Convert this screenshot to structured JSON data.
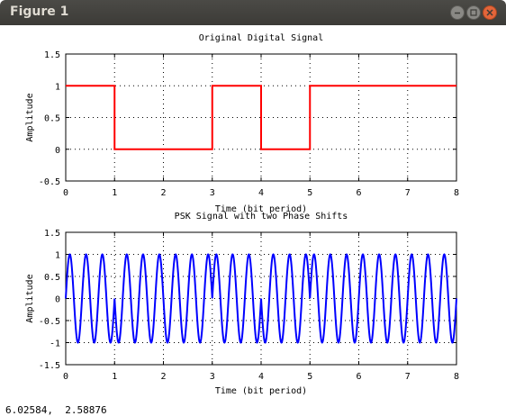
{
  "window": {
    "title": "Figure 1"
  },
  "status": {
    "coords": "6.02584,  2.58876"
  },
  "chart_data": [
    {
      "type": "line",
      "title": "Original Digital Signal",
      "xlabel": "Time (bit period)",
      "ylabel": "Amplitude",
      "xlim": [
        0,
        8
      ],
      "ylim": [
        -0.5,
        1.5
      ],
      "xticks": [
        "0",
        "1",
        "2",
        "3",
        "4",
        "5",
        "6",
        "7",
        "8"
      ],
      "yticks": [
        "-0.5",
        "0",
        "0.5",
        "1",
        "1.5"
      ],
      "grid": true,
      "series": [
        {
          "color": "#ff0000",
          "bits": [
            1,
            0,
            0,
            1,
            0,
            1,
            1,
            1
          ]
        }
      ]
    },
    {
      "type": "line",
      "title": "PSK Signal with two Phase Shifts",
      "xlabel": "Time (bit period)",
      "ylabel": "Amplitude",
      "xlim": [
        0,
        8
      ],
      "ylim": [
        -1.5,
        1.5
      ],
      "xticks": [
        "0",
        "1",
        "2",
        "3",
        "4",
        "5",
        "6",
        "7",
        "8"
      ],
      "yticks": [
        "-1.5",
        "-1",
        "-0.5",
        "0",
        "0.5",
        "1",
        "1.5"
      ],
      "grid": true,
      "series": [
        {
          "color": "#0000ff",
          "carrier_cycles_per_bit": 3,
          "phase_rad_when_bit_0": 3.14159,
          "bits": [
            1,
            0,
            0,
            1,
            0,
            1,
            1,
            1
          ]
        }
      ]
    }
  ]
}
